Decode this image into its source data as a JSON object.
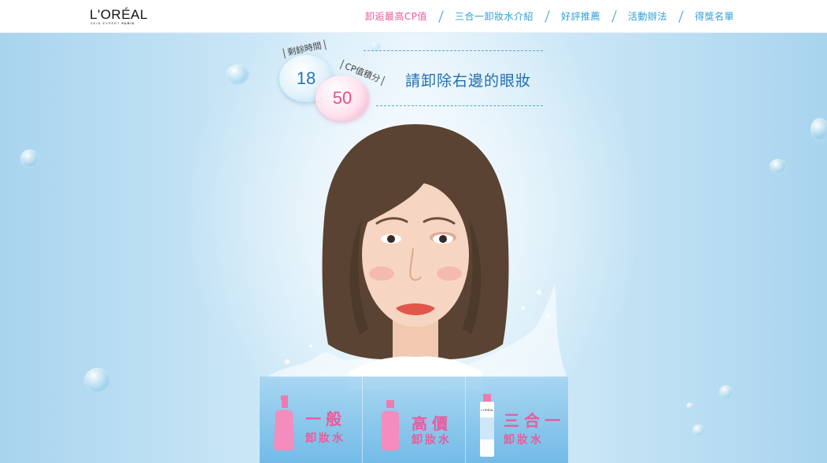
{
  "brand": {
    "logo_text": "L'ORÉAL",
    "logo_sub_light": "SKIN EXPERT",
    "logo_sub_bold": "PARIS"
  },
  "nav": {
    "items": [
      {
        "label": "卸逅最高CP值",
        "active": true
      },
      {
        "label": "三合一卸妝水介紹",
        "active": false
      },
      {
        "label": "好評推薦",
        "active": false
      },
      {
        "label": "活動辦法",
        "active": false
      },
      {
        "label": "得獎名單",
        "active": false
      }
    ]
  },
  "game": {
    "time_label": "剩餘時間",
    "time_value": "18",
    "score_label": "CP值積分",
    "score_value": "50",
    "instruction": "請卸除右邊的眼妝"
  },
  "options": [
    {
      "title": "一般",
      "subtitle": "卸妝水",
      "color": "#ea5a9b"
    },
    {
      "title": "高價",
      "subtitle": "卸妝水",
      "color": "#ea5a9b"
    },
    {
      "title": "三合一",
      "subtitle": "卸妝水",
      "color": "#ea5a9b"
    }
  ],
  "product_label": "L'ORÉAL",
  "colors": {
    "accent_pink": "#ea5a9b",
    "accent_blue": "#2f9fd6",
    "instruction_blue": "#1f6fb0"
  },
  "icons": [
    "pink-pump-bottle-icon",
    "pink-bottle-icon",
    "micellar-water-bottle-icon"
  ]
}
